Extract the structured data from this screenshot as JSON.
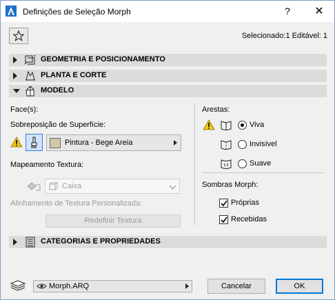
{
  "window": {
    "title": "Definições de Seleção Morph",
    "help": "?",
    "close": "✕"
  },
  "header": {
    "selection_info": "Selecionado:1 Editável: 1"
  },
  "sections": {
    "geometry": "GEOMETRIA E POSICIONAMENTO",
    "plan": "PLANTA E CORTE",
    "model": "MODELO",
    "categories": "CATEGORIAS E PROPRIEDADES"
  },
  "model": {
    "faces_label": "Face(s):",
    "surface_override_label": "Sobreposição de Superfície:",
    "surface_value": "Pintura - Bege Areia",
    "surface_color": "#d3c7aa",
    "texture_mapping_label": "Mapeamento Textura:",
    "texture_mapping_value": "Caixa",
    "custom_alignment_label": "Alinhamento de Textura Personalizada:",
    "reset_texture_button": "Redefinir Textura",
    "edges_label": "Arestas:",
    "edges": [
      {
        "label": "Viva",
        "selected": true
      },
      {
        "label": "Invisível",
        "selected": false
      },
      {
        "label": "Suave",
        "selected": false
      }
    ],
    "shadows_label": "Sombras Morph:",
    "shadows": [
      {
        "label": "Próprias",
        "checked": true
      },
      {
        "label": "Recebidas",
        "checked": true
      }
    ]
  },
  "footer": {
    "layer_value": "Morph.ARQ",
    "cancel": "Cancelar",
    "ok": "OK"
  },
  "colors": {
    "warning": "#f2c811",
    "accent": "#0078d7"
  }
}
